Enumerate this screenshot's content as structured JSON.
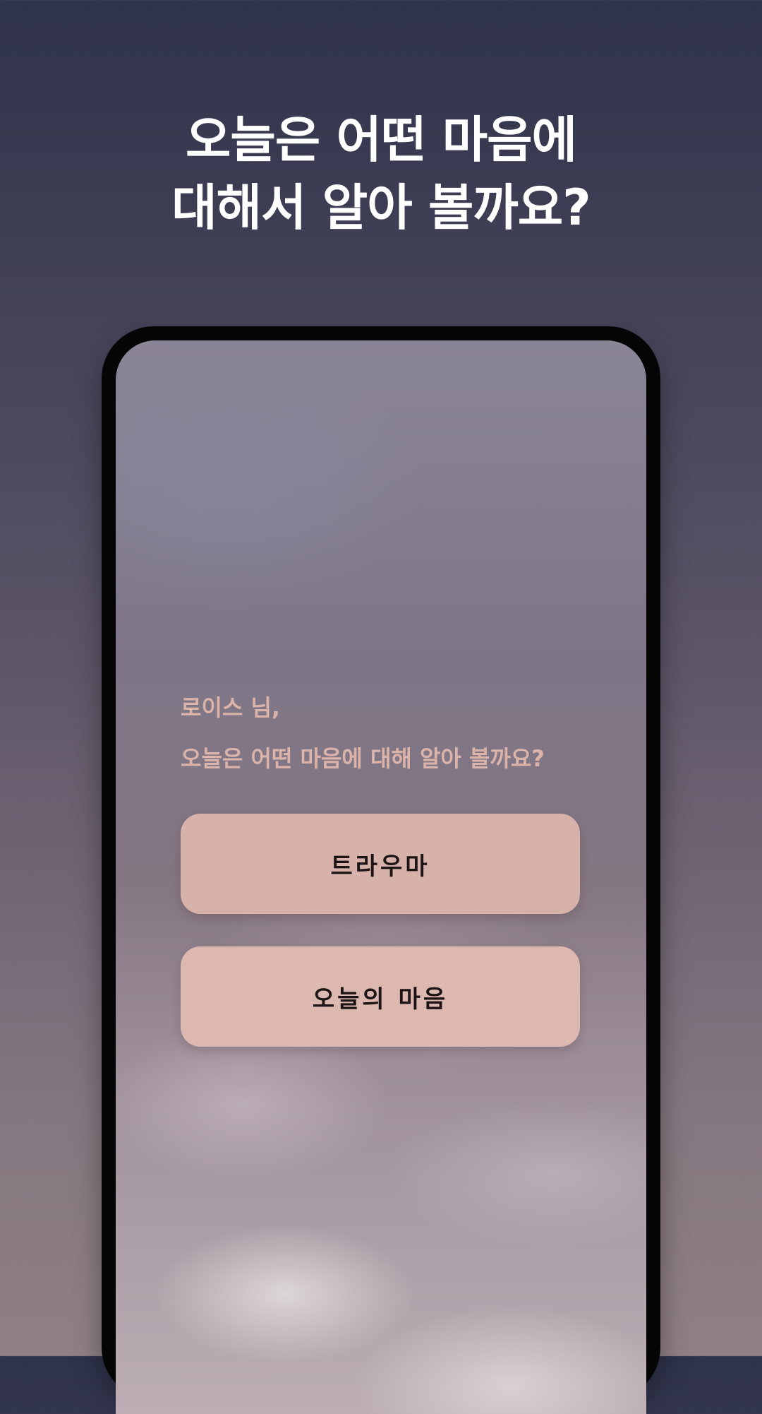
{
  "headline": {
    "line1": "오늘은 어떤 마음에",
    "line2": "대해서 알아 볼까요?"
  },
  "screen": {
    "greeting_line1": "로이스 님,",
    "greeting_line2": "오늘은 어떤 마음에 대해 알아 볼까요?",
    "options": [
      {
        "label": "트라우마"
      },
      {
        "label": "오늘의 마음"
      }
    ]
  },
  "colors": {
    "greeting_text": "#dcb3a9",
    "button_bg": "#d6b2ab",
    "headline_text": "#ffffff",
    "phone_frame": "#050505"
  }
}
